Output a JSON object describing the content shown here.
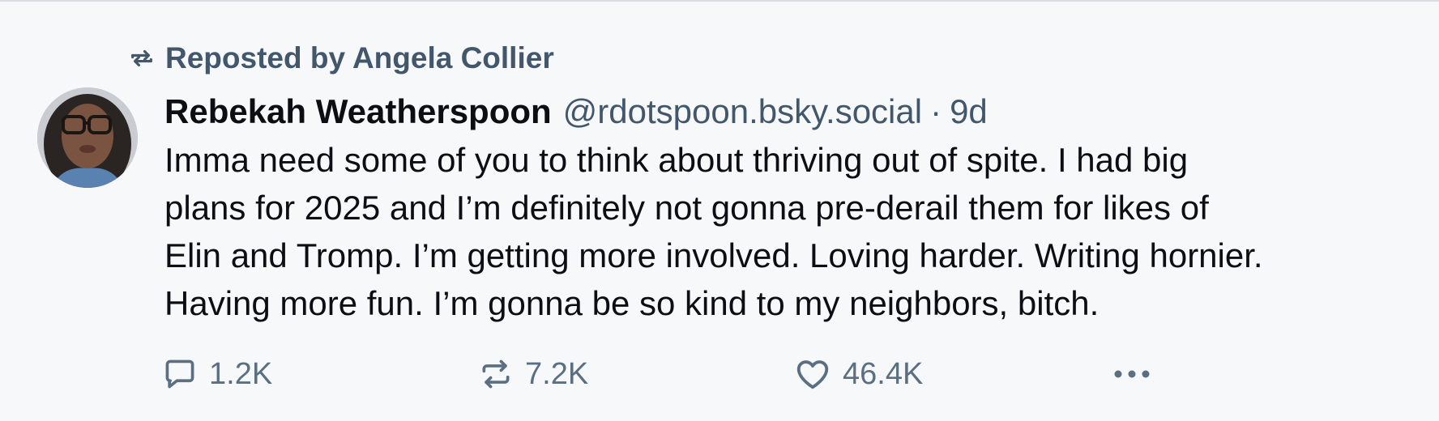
{
  "repost_banner": {
    "text": "Reposted by Angela Collier"
  },
  "author": {
    "display_name": "Rebekah Weatherspoon",
    "handle": "@rdotspoon.bsky.social",
    "separator": "·",
    "time": "9d"
  },
  "post": {
    "lines": [
      "Imma need some of you to think about thriving out of spite. I had big",
      "plans for 2025 and I’m definitely not gonna pre-derail them for likes of",
      "Elin and Tromp. I’m getting more involved. Loving harder. Writing hornier.",
      "Having more fun. I’m gonna be so kind to my neighbors, bitch."
    ]
  },
  "actions": {
    "reply_count": "1.2K",
    "repost_count": "7.2K",
    "like_count": "46.4K"
  },
  "icons": {
    "repost_banner_icon": "repost-icon",
    "reply_icon": "speech-bubble-icon",
    "repost_icon": "repost-icon",
    "like_icon": "heart-icon",
    "more_icon": "ellipsis-icon"
  },
  "colors": {
    "background": "#f7f8fa",
    "text": "#0b0f14",
    "muted": "#42576c",
    "action": "#5b6f82"
  }
}
